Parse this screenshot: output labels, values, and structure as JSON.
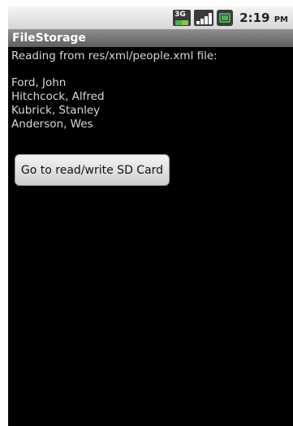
{
  "status_bar": {
    "network_label": "3G",
    "time": "2:19",
    "ampm": "PM"
  },
  "icons": {
    "network": "3g-icon",
    "signal": "signal-strength-icon",
    "battery": "battery-icon"
  },
  "app": {
    "title": "FileStorage"
  },
  "content": {
    "intro": "Reading from res/xml/people.xml file:",
    "people": [
      "Ford, John",
      "Hitchcock, Alfred",
      "Kubrick, Stanley",
      "Anderson, Wes"
    ],
    "button_label": "Go to read/write SD Card"
  },
  "colors": {
    "screen_bg": "#000000",
    "text": "#d8d8d8",
    "accent_green": "#4caf50"
  }
}
